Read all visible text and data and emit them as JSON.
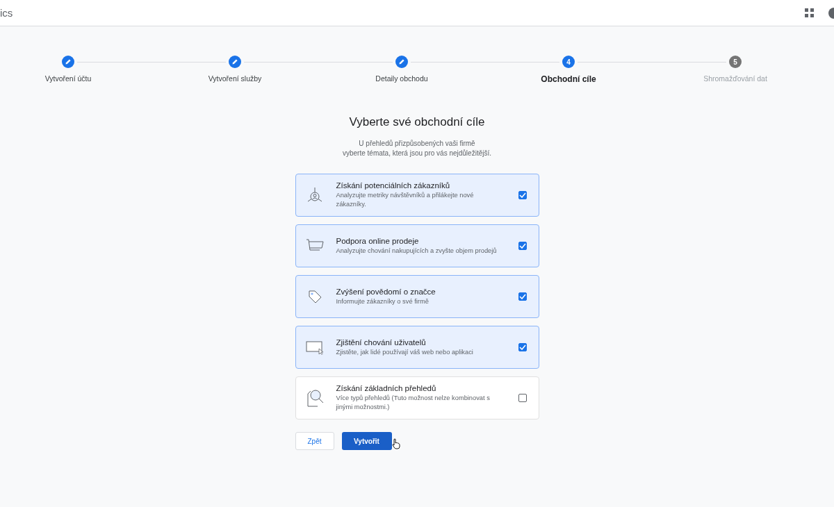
{
  "app_bar": {
    "title": "ics"
  },
  "steps": [
    {
      "label": "Vytvoření účtu",
      "completed": true,
      "selected": false
    },
    {
      "label": "Vytvoření služby",
      "completed": true,
      "selected": false
    },
    {
      "label": "Detaily obchodu",
      "completed": true,
      "selected": false
    },
    {
      "label": "Obchodní cíle",
      "number": "4",
      "completed": false,
      "selected": true
    },
    {
      "label": "Shromažďování dat",
      "number": "5",
      "completed": false,
      "selected": false
    }
  ],
  "heading": "Vyberte své obchodní cíle",
  "subtitle": [
    "U přehledů přizpůsobených vaši firmě",
    "vyberte témata, která jsou pro vás nejdůležitější."
  ],
  "goals": [
    {
      "kind": "leads",
      "title": "Získání potenciálních zákazníků",
      "description": "Analyzujte metriky návštěvníků a přilákejte nové zákazníky.",
      "checked": true
    },
    {
      "kind": "cart",
      "title": "Podpora online prodeje",
      "description": "Analyzujte chování nakupujících a zvyšte objem prodejů",
      "checked": true
    },
    {
      "kind": "tag",
      "title": "Zvýšení povědomí o značce",
      "description": "Informujte zákazníky o své firmě",
      "checked": true
    },
    {
      "kind": "screen",
      "title": "Zjištění chování uživatelů",
      "description": "Zjistěte, jak lidé používají váš web nebo aplikaci",
      "checked": true
    },
    {
      "kind": "search",
      "title": "Získání základních přehledů",
      "description": "Více typů přehledů (Tuto možnost nelze kombinovat s jinými možnostmi.)",
      "checked": false
    }
  ],
  "buttons": {
    "back": "Zpět",
    "create": "Vytvořit"
  }
}
